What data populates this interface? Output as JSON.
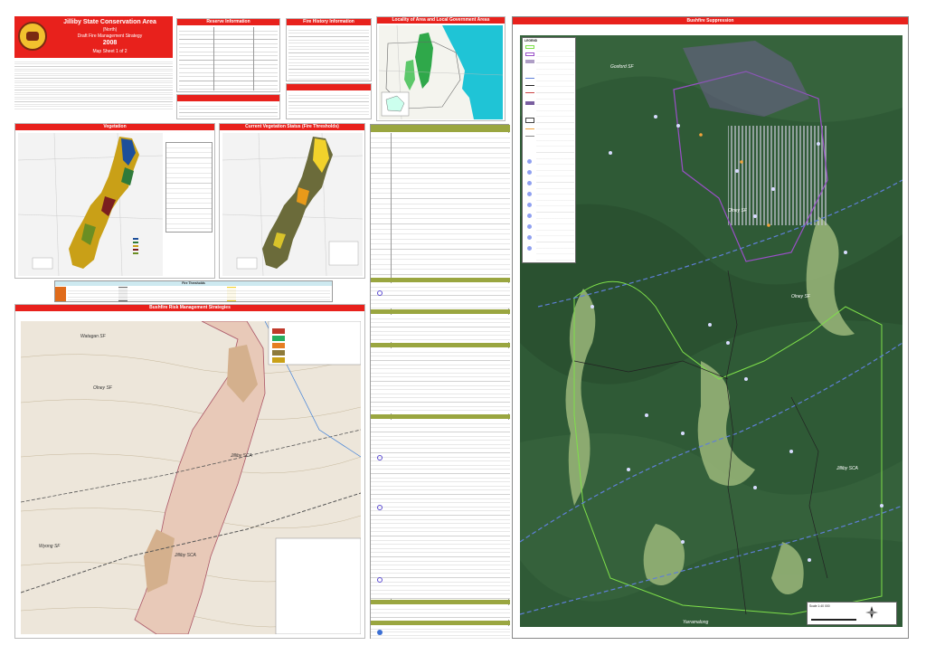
{
  "title_block": {
    "title": "Jilliby State Conservation Area",
    "subtitle": "(North)",
    "doc": "Draft Fire Management Strategy",
    "year": "2008",
    "sheet": "Map Sheet 1 of 2"
  },
  "panels": {
    "reserve_info": "Reserve Information",
    "fire_history": "Fire History Information",
    "locality": "Locality of Area and Local Government Areas",
    "vegetation": "Vegetation",
    "veg_status": "Current Vegetation Status (Fire Thresholds)",
    "strategies": "Bushfire Risk Management Strategies",
    "suppression": "Bushfire Suppression",
    "legend": "LEGEND",
    "fire_thresholds": "Fire Thresholds",
    "contacts": "Contacts"
  },
  "map_labels": {
    "suppression": [
      "Gosford SF",
      "Olney SF",
      "Olney SF",
      "Jilliby SCA",
      "Yarramalong"
    ],
    "strategies": [
      "Watagan SF",
      "Olney SF",
      "Jilliby SCA",
      "Jilliby SCA",
      "Wyong SF"
    ]
  },
  "scale": {
    "label": "Scale 1:40 000",
    "north": "N"
  },
  "colors": {
    "accent": "#e8211c",
    "olive": "#9aa640",
    "forest": "#2f5a36",
    "boundary": "#7fe04a"
  }
}
